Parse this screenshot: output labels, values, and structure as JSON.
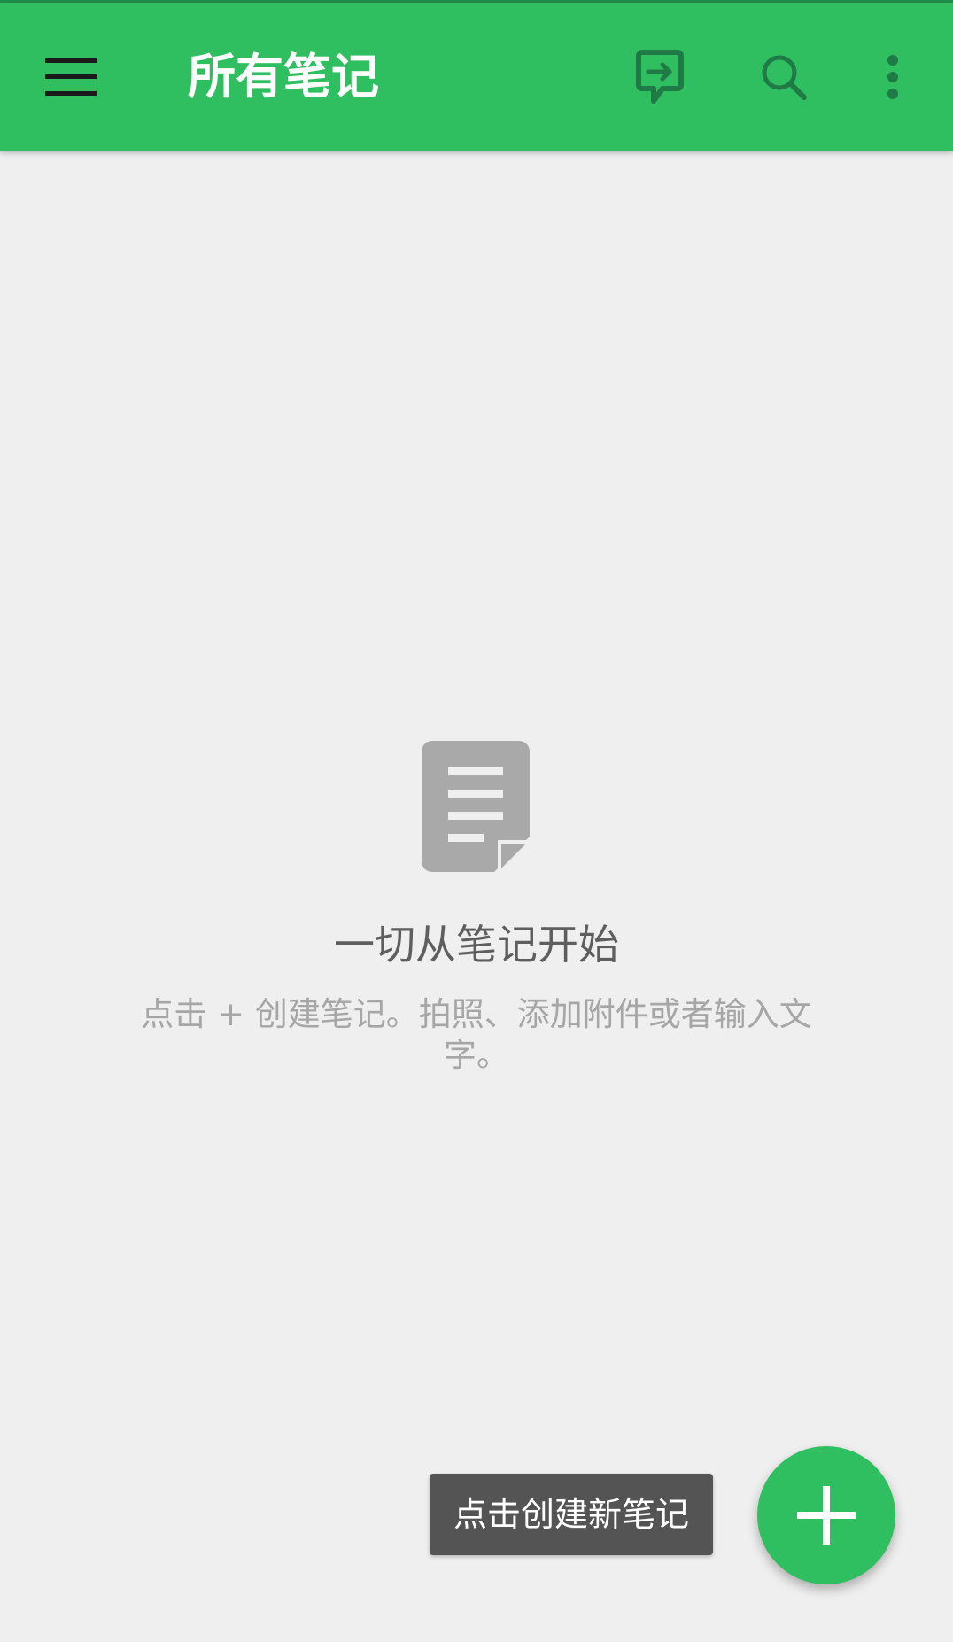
{
  "toolbar": {
    "title": "所有笔记",
    "icons": {
      "menu": "hamburger-menu-icon",
      "sync": "sync-chat-icon",
      "search": "search-icon",
      "more": "more-vertical-icon"
    },
    "colors": {
      "background": "#30bf60",
      "title": "#ffffff",
      "menu_icon": "#1a1a1a",
      "action_icons": "#1f7a45"
    }
  },
  "empty_state": {
    "icon": "note-document-icon",
    "title": "一切从笔记开始",
    "description": "点击 + 创建笔记。拍照、添加附件或者输入文字。"
  },
  "fab": {
    "icon": "plus-icon",
    "tooltip": "点击创建新笔记",
    "color": "#30bf60"
  },
  "colors": {
    "page_background": "#efefef",
    "empty_title": "#5e5e5e",
    "empty_description": "#a6a6a6",
    "tooltip_background": "#545454"
  }
}
